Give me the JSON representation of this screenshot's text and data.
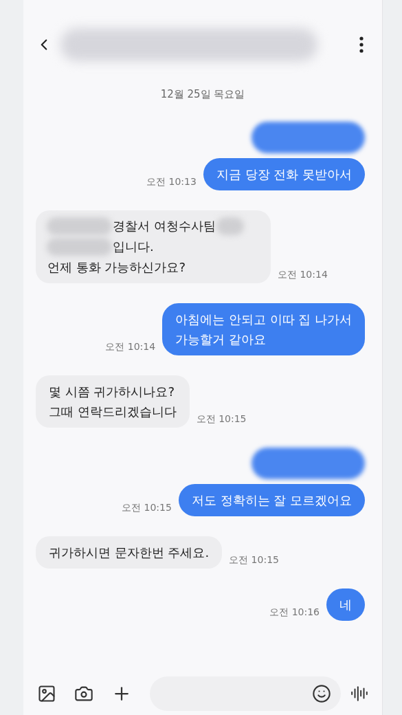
{
  "header": {
    "title": {
      "kind": "redacted"
    }
  },
  "date_divider": "12월 25일 목요일",
  "messages": [
    {
      "outgoing": true,
      "kind": "redacted"
    },
    {
      "outgoing": true,
      "kind": "text",
      "text": "지금 당장 전화 못받아서",
      "time": "오전 10:13"
    },
    {
      "outgoing": false,
      "kind": "mixed",
      "lines": [
        [
          {
            "kind": "redacted"
          },
          {
            "kind": "text",
            "text": "경찰서 여청수사팀"
          },
          {
            "kind": "redacted"
          }
        ],
        [
          {
            "kind": "redacted"
          },
          {
            "kind": "text",
            "text": "입니다."
          }
        ],
        [
          {
            "kind": "text",
            "text": "언제 통화 가능하신가요?"
          }
        ]
      ],
      "time": "오전 10:14"
    },
    {
      "outgoing": true,
      "kind": "text",
      "text": "아침에는 안되고 이따 집 나가서\n가능할거 같아요",
      "time": "오전 10:14"
    },
    {
      "outgoing": false,
      "kind": "text",
      "text": "몇 시쯤 귀가하시나요?\n그때 연락드리겠습니다",
      "time": "오전 10:15"
    },
    {
      "outgoing": true,
      "kind": "redacted"
    },
    {
      "outgoing": true,
      "kind": "text",
      "text": "저도 정확히는 잘 모르겠어요",
      "time": "오전 10:15"
    },
    {
      "outgoing": false,
      "kind": "text",
      "text": "귀가하시면 문자한번 주세요.",
      "time": "오전 10:15"
    },
    {
      "outgoing": true,
      "kind": "text",
      "text": "네",
      "time": "오전 10:16"
    }
  ]
}
